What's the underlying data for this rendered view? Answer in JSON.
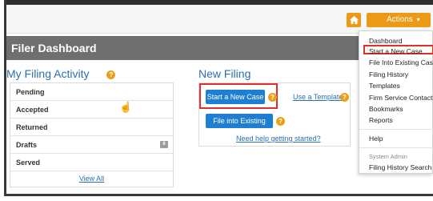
{
  "topbar": {
    "home_icon": "home-icon",
    "actions_label": "Actions",
    "actions_caret": "▾"
  },
  "dashboard": {
    "title": "Filer Dashboard"
  },
  "filing_activity": {
    "title": "My Filing Activity",
    "items": [
      {
        "label": "Pending"
      },
      {
        "label": "Accepted"
      },
      {
        "label": "Returned"
      },
      {
        "label": "Drafts",
        "badge": "6"
      },
      {
        "label": "Served"
      }
    ],
    "view_all_label": "View All"
  },
  "new_filing": {
    "title": "New Filing",
    "start_case_label": "Start a New Case",
    "use_template_label": "Use a Template",
    "file_existing_label": "File into Existing Case",
    "help_link_label": "Need help getting started?"
  },
  "actions_menu": {
    "items": [
      {
        "label": "Dashboard"
      },
      {
        "label": "Start a New Case"
      },
      {
        "label": "File Into Existing Case"
      },
      {
        "label": "Filing History"
      },
      {
        "label": "Templates"
      },
      {
        "label": "Firm Service Contacts"
      },
      {
        "label": "Bookmarks"
      },
      {
        "label": "Reports"
      },
      {
        "label": "Help"
      },
      {
        "label": "System Admin"
      },
      {
        "label": "Filing History Search"
      }
    ]
  },
  "colors": {
    "accent_orange": "#ec9a15",
    "header_gray": "#6f6f6f",
    "button_blue": "#1e7fd2",
    "highlight_red": "#e0302a",
    "link_blue": "#2a6fb0"
  }
}
